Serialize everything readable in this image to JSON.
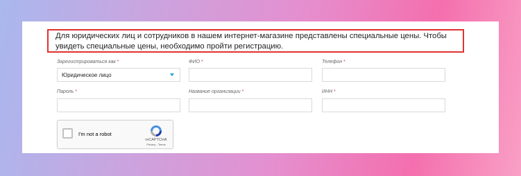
{
  "notice": {
    "text": "Для юридических лиц и сотрудников в нашем интернет-магазине представлены специальные цены. Чтобы увидеть специальные цены, необходимо пройти регистрацию."
  },
  "form": {
    "register_as": {
      "label": "Зарегистрироваться как",
      "required": "*",
      "value": "Юридическое лицо"
    },
    "fio": {
      "label": "ФИО",
      "required": "*"
    },
    "phone": {
      "label": "Телефон",
      "required": "*"
    },
    "password": {
      "label": "Пароль",
      "required": "*"
    },
    "org_name": {
      "label": "Название организации",
      "required": "*"
    },
    "inn": {
      "label": "ИНН",
      "required": "*"
    }
  },
  "captcha": {
    "label": "I'm not a robot",
    "brand": "reCAPTCHA",
    "links": "Privacy - Terms"
  },
  "colors": {
    "notice_border": "#e0322f",
    "required_marker": "#e03a3a",
    "select_caret": "#1a9ed9",
    "captcha_blue": "#4a90e2"
  }
}
